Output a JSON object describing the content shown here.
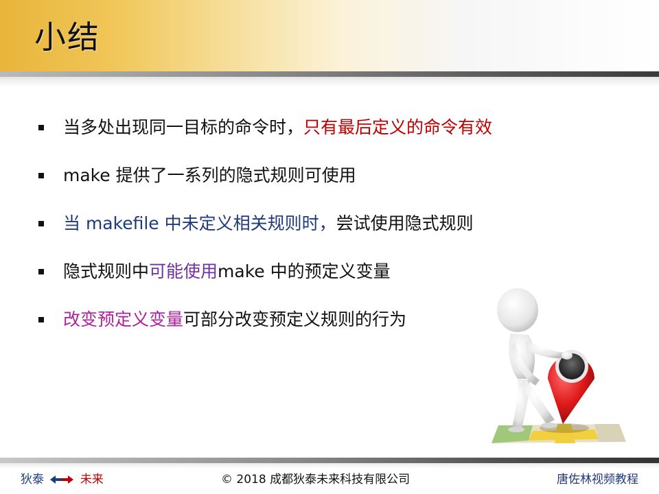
{
  "title": "小结",
  "bullets": [
    {
      "segments": [
        {
          "text": "当多处出现同一目标的命令时，",
          "color": "black"
        },
        {
          "text": "只有最后定义的命令有效",
          "color": "red"
        }
      ]
    },
    {
      "segments": [
        {
          "text": "make 提供了一系列的隐式规则可使用",
          "color": "black"
        }
      ]
    },
    {
      "segments": [
        {
          "text": "当 makefile 中未定义相关规则时，",
          "color": "navy"
        },
        {
          "text": "尝试使用隐式规则",
          "color": "black"
        }
      ]
    },
    {
      "segments": [
        {
          "text": "隐式规则中",
          "color": "black"
        },
        {
          "text": "可能使用",
          "color": "purple"
        },
        {
          "text": "make 中的预定义变量",
          "color": "black"
        }
      ]
    },
    {
      "segments": [
        {
          "text": "改变预定义变量",
          "color": "magenta"
        },
        {
          "text": "可部分改变预定义规则的行为",
          "color": "black"
        }
      ]
    }
  ],
  "footer": {
    "left_word": "狄泰",
    "arrows_icon": "double-arrow-icon",
    "right_word": "未来",
    "copyright": "© 2018 成都狄泰未来科技有限公司",
    "author": "唐佐林视频教程"
  },
  "colors": {
    "title_band": "#e9b53a",
    "red": "#c00000",
    "navy": "#1f3a7a",
    "purple": "#7030a0",
    "magenta": "#b0209c"
  },
  "illustration_icon": "person-leaning-on-map-pin-icon"
}
